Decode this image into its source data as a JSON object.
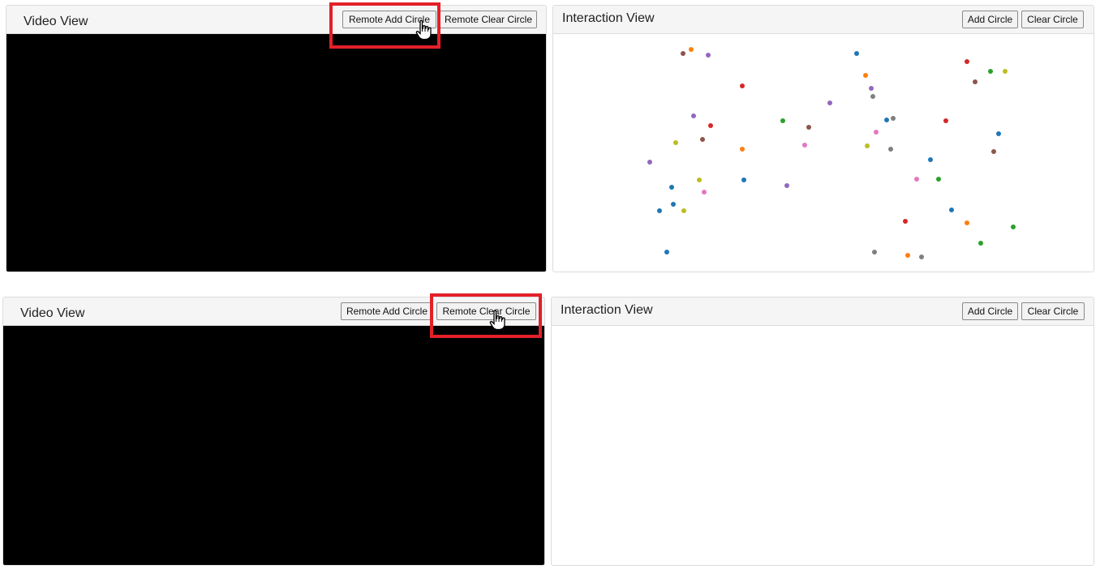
{
  "top": {
    "video": {
      "title": "Video View",
      "remote_add_label": "Remote Add Circle",
      "remote_clear_label": "Remote Clear Circle"
    },
    "interaction": {
      "title": "Interaction View",
      "add_label": "Add Circle",
      "clear_label": "Clear Circle",
      "circle_colors": [
        "#1f77b4",
        "#ff7f0e",
        "#2ca02c",
        "#d62728",
        "#9467bd",
        "#8c564b",
        "#e377c2",
        "#7f7f7f",
        "#bcbd22"
      ],
      "circle_count": 54
    }
  },
  "bottom": {
    "video": {
      "title": "Video View",
      "remote_add_label": "Remote Add Circle",
      "remote_clear_label": "Remote Clear Circle"
    },
    "interaction": {
      "title": "Interaction View",
      "add_label": "Add Circle",
      "clear_label": "Clear Circle",
      "circle_count": 0
    }
  }
}
